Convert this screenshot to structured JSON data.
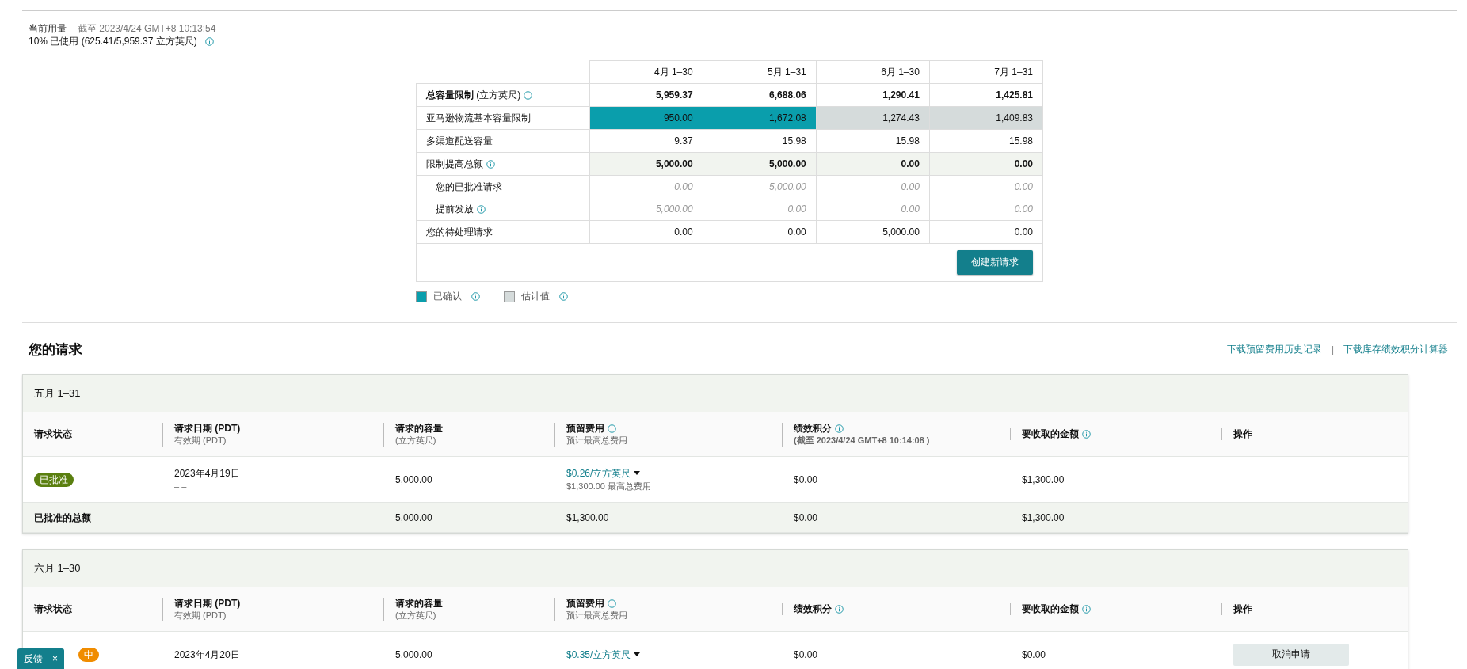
{
  "usage": {
    "label": "当前用量",
    "as_of": "截至 2023/4/24 GMT+8 10:13:54",
    "used": "10% 已使用 (625.41/5,959.37 立方英尺)",
    "info": true
  },
  "capacity_table": {
    "columns": [
      "4月 1–30",
      "5月 1–31",
      "6月 1–30",
      "7月 1–31"
    ],
    "rows": [
      {
        "kind": "total",
        "label": "总容量限制",
        "unit": "(立方英尺)",
        "info": true,
        "cells": [
          {
            "value": "5,959.37"
          },
          {
            "value": "6,688.06"
          },
          {
            "value": "1,290.41"
          },
          {
            "value": "1,425.81"
          }
        ]
      },
      {
        "kind": "base",
        "label": "亚马逊物流基本容量限制",
        "info": false,
        "cells": [
          {
            "value": "950.00",
            "kind": "confirmed"
          },
          {
            "value": "1,672.08",
            "kind": "confirmed"
          },
          {
            "value": "1,274.43",
            "kind": "estimated"
          },
          {
            "value": "1,409.83",
            "kind": "estimated"
          }
        ]
      },
      {
        "kind": "plain",
        "label": "多渠道配送容量",
        "info": false,
        "cells": [
          {
            "value": "9.37"
          },
          {
            "value": "15.98"
          },
          {
            "value": "15.98"
          },
          {
            "value": "15.98"
          }
        ]
      },
      {
        "kind": "increase",
        "label": "限制提高总额",
        "info": true,
        "cells": [
          {
            "value": "5,000.00"
          },
          {
            "value": "5,000.00"
          },
          {
            "value": "0.00"
          },
          {
            "value": "0.00"
          }
        ]
      },
      {
        "kind": "sub",
        "label": "您的已批准请求",
        "info": false,
        "cells": [
          {
            "value": "0.00"
          },
          {
            "value": "5,000.00"
          },
          {
            "value": "0.00"
          },
          {
            "value": "0.00"
          }
        ]
      },
      {
        "kind": "sub",
        "label": "提前发放",
        "info": true,
        "cells": [
          {
            "value": "5,000.00"
          },
          {
            "value": "0.00"
          },
          {
            "value": "0.00"
          },
          {
            "value": "0.00"
          }
        ]
      },
      {
        "kind": "plain",
        "label": "您的待处理请求",
        "info": false,
        "cells": [
          {
            "value": "0.00"
          },
          {
            "value": "0.00"
          },
          {
            "value": "5,000.00"
          },
          {
            "value": "0.00"
          }
        ]
      }
    ],
    "create_button": "创建新请求",
    "legend": [
      {
        "label": "已确认",
        "kind": "confirmed"
      },
      {
        "label": "估计值",
        "kind": "estimated"
      }
    ]
  },
  "requests": {
    "title": "您的请求",
    "links": [
      "下载预留费用历史记录",
      "下载库存绩效积分计算器"
    ],
    "link_separator": "|",
    "groups": [
      {
        "title": "五月 1–31",
        "columns": [
          {
            "label": "请求状态",
            "info": false
          },
          {
            "label": "请求日期 (PDT)",
            "sublabel": "有效期 (PDT)",
            "info": false
          },
          {
            "label": "请求的容量",
            "sublabel": "(立方英尺)",
            "info": false
          },
          {
            "label": "预留费用",
            "sublabel": "预计最高总费用",
            "info": true
          },
          {
            "label": "绩效积分",
            "sublabel": "(截至 2023/4/24 GMT+8 10:14:08 )",
            "info": true
          },
          {
            "label": "要收取的金额",
            "info": true
          },
          {
            "label": "操作",
            "info": false
          }
        ],
        "rows": [
          {
            "status": {
              "label": "已批准",
              "kind": "approved"
            },
            "date": "2023年4月19日",
            "expiry": "– –",
            "capacity": "5,000.00",
            "fee": "$0.26/立方英尺",
            "fee_max": "$1,300.00 最高总费用",
            "performance": "$0.00",
            "amount": "$1,300.00"
          }
        ],
        "total": {
          "label": "已批准的总额",
          "capacity": "5,000.00",
          "fee": "$1,300.00",
          "performance": "$0.00",
          "amount": "$1,300.00"
        }
      },
      {
        "title": "六月 1–30",
        "columns": [
          {
            "label": "请求状态",
            "info": false
          },
          {
            "label": "请求日期 (PDT)",
            "sublabel": "有效期 (PDT)",
            "info": false
          },
          {
            "label": "请求的容量",
            "sublabel": "(立方英尺)",
            "info": false
          },
          {
            "label": "预留费用",
            "sublabel": "预计最高总费用",
            "info": true
          },
          {
            "label": "绩效积分",
            "info": true
          },
          {
            "label": "要收取的金额",
            "info": true
          },
          {
            "label": "操作",
            "info": false
          }
        ],
        "rows": [
          {
            "status": {
              "label": "中",
              "kind": "pending"
            },
            "date": "2023年4月20日",
            "capacity": "5,000.00",
            "fee": "$0.35/立方英尺",
            "performance": "$0.00",
            "amount": "$0.00",
            "action": "取消申请"
          }
        ]
      }
    ]
  },
  "feedback": {
    "label": "反馈",
    "close": "×"
  }
}
